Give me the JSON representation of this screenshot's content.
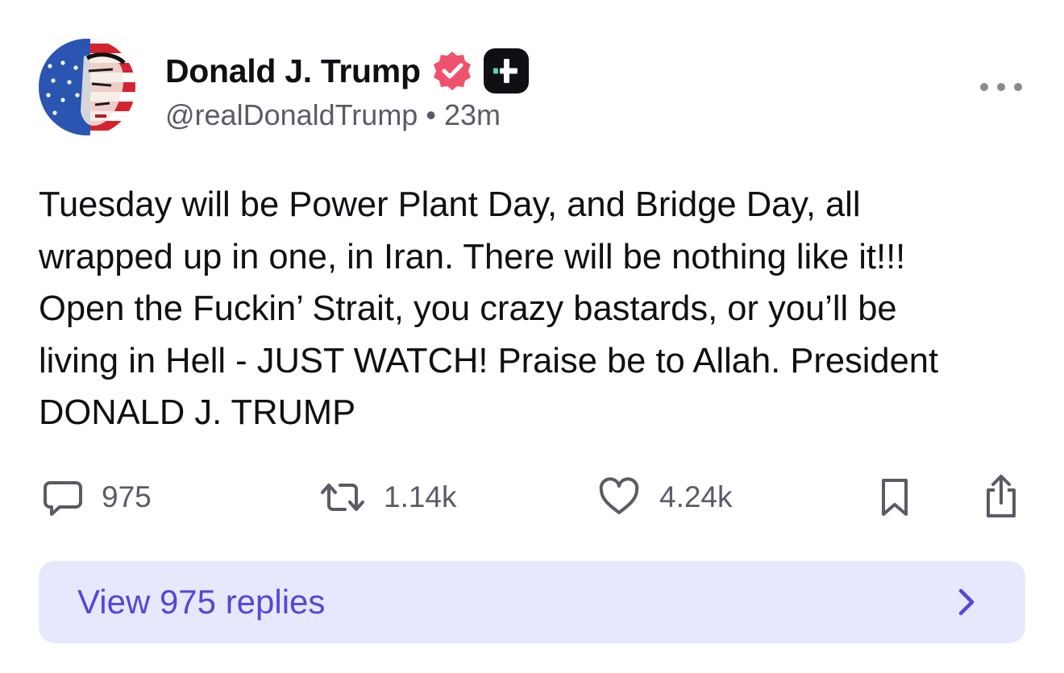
{
  "author": {
    "display_name": "Donald J. Trump",
    "handle": "@realDonaldTrump",
    "separator": "•",
    "time_ago": "23m",
    "avatar": "avatar-flag-portrait",
    "verified_color": "#f0516c",
    "badge_icon": "plus-badge-icon"
  },
  "post": {
    "text": "Tuesday will be Power Plant Day, and Bridge Day, all\nwrapped up in one, in Iran. There will be nothing like it!!!\nOpen the Fuckin’ Strait, you crazy bastards, or you’ll be\nliving in Hell - JUST WATCH! Praise be to Allah. President\nDONALD J. TRUMP"
  },
  "actions": {
    "replies": {
      "icon": "comment-icon",
      "count": "975"
    },
    "reposts": {
      "icon": "repost-icon",
      "count": "1.14k"
    },
    "likes": {
      "icon": "heart-icon",
      "count": "4.24k"
    },
    "bookmark": {
      "icon": "bookmark-icon"
    },
    "share": {
      "icon": "share-icon"
    }
  },
  "more_menu": {
    "icon": "more-dots-icon"
  },
  "view_replies": {
    "label": "View 975 replies",
    "icon": "chevron-right-icon",
    "accent": "#5547d6",
    "background": "#e6e8fd"
  }
}
